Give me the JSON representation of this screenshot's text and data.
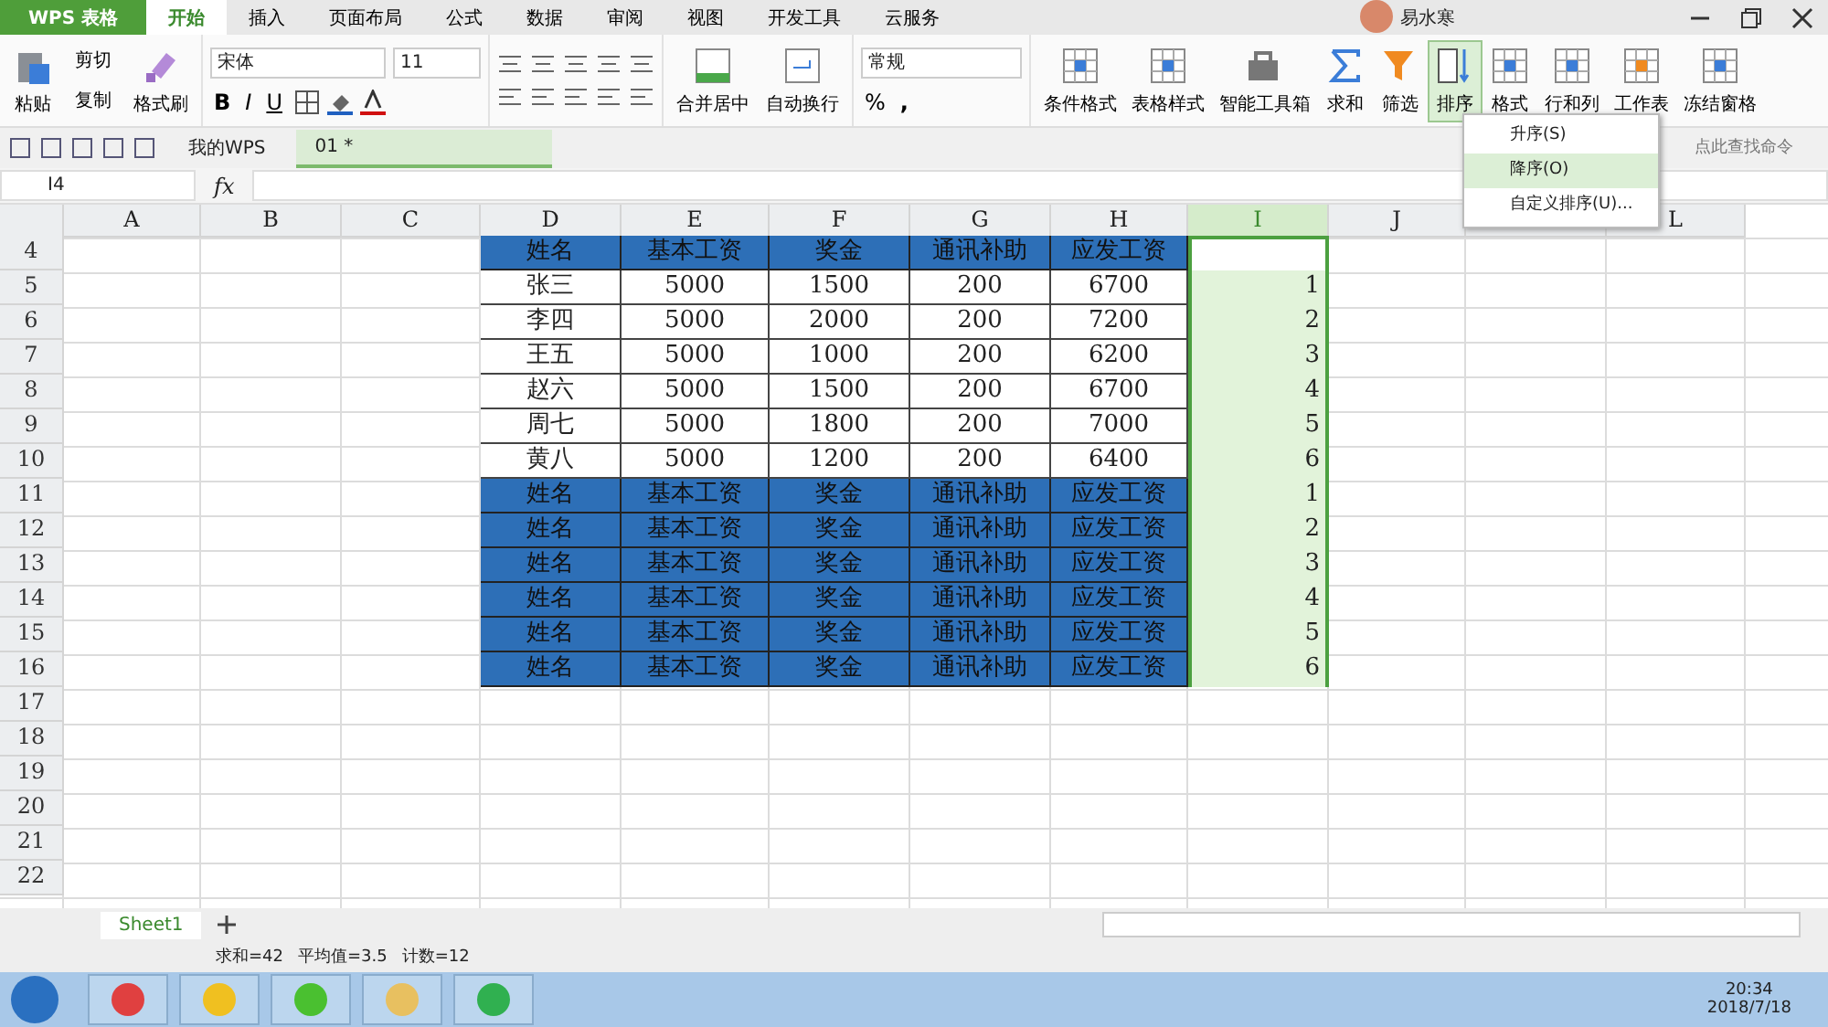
{
  "app_button": {
    "label": "WPS 表格"
  },
  "menu_tabs": [
    {
      "label": "开始",
      "selected": true
    },
    {
      "label": "插入",
      "selected": false
    },
    {
      "label": "页面布局",
      "selected": false
    },
    {
      "label": "公式",
      "selected": false
    },
    {
      "label": "数据",
      "selected": false
    },
    {
      "label": "审阅",
      "selected": false
    },
    {
      "label": "视图",
      "selected": false
    },
    {
      "label": "开发工具",
      "selected": false
    },
    {
      "label": "云服务",
      "selected": false
    }
  ],
  "user": {
    "name": "易水寒"
  },
  "ribbon": {
    "paste": "粘贴",
    "cut": "剪切",
    "copy": "复制",
    "format_painter": "格式刷",
    "font": "宋体",
    "font_size": "11",
    "bold": "B",
    "italic": "I",
    "underline": "U",
    "merge": "合并居中",
    "wrap": "自动换行",
    "number_format": "常规",
    "percent": "%",
    "comma": ",",
    "big_buttons": [
      {
        "label": "条件格式",
        "kind": "cond",
        "active": false
      },
      {
        "label": "表格样式",
        "kind": "style",
        "active": false
      },
      {
        "label": "智能工具箱",
        "kind": "tools",
        "active": false
      },
      {
        "label": "求和",
        "kind": "sum",
        "active": false
      },
      {
        "label": "筛选",
        "kind": "filter",
        "active": false
      },
      {
        "label": "排序",
        "kind": "sort",
        "active": true
      },
      {
        "label": "格式",
        "kind": "format",
        "active": false
      },
      {
        "label": "行和列",
        "kind": "rowcol",
        "active": false
      },
      {
        "label": "工作表",
        "kind": "sheet",
        "active": false
      },
      {
        "label": "冻结窗格",
        "kind": "freeze",
        "active": false
      }
    ]
  },
  "doc_tabs": [
    {
      "label": "我的WPS",
      "selected": false
    },
    {
      "label": "01 *",
      "selected": true
    }
  ],
  "command_search": {
    "placeholder": "点此查找命令"
  },
  "sort_menu": [
    {
      "label": "升序(S)",
      "selected": false
    },
    {
      "label": "降序(O)",
      "selected": true
    },
    {
      "label": "自定义排序(U)...",
      "selected": false
    }
  ],
  "formula_bar": {
    "cell": "I4",
    "fx": "fx"
  },
  "columns": [
    {
      "label": "A",
      "selected": false
    },
    {
      "label": "B",
      "selected": false
    },
    {
      "label": "C",
      "selected": false
    },
    {
      "label": "D",
      "selected": false
    },
    {
      "label": "E",
      "selected": false
    },
    {
      "label": "F",
      "selected": false
    },
    {
      "label": "G",
      "selected": false
    },
    {
      "label": "H",
      "selected": false
    },
    {
      "label": "I",
      "selected": true
    },
    {
      "label": "J",
      "selected": false
    },
    {
      "selected": false
    },
    {
      "label": "L",
      "selected": false
    }
  ],
  "rows": [
    {
      "num": "4",
      "kind": "header",
      "cells": [
        "姓名",
        "基本工资",
        "奖金",
        "通讯补助",
        "应发工资"
      ],
      "index": ""
    },
    {
      "num": "5",
      "kind": "data",
      "cells": [
        "张三",
        "5000",
        "1500",
        "200",
        "6700"
      ],
      "index": "1"
    },
    {
      "num": "6",
      "kind": "data",
      "cells": [
        "李四",
        "5000",
        "2000",
        "200",
        "7200"
      ],
      "index": "2"
    },
    {
      "num": "7",
      "kind": "data",
      "cells": [
        "王五",
        "5000",
        "1000",
        "200",
        "6200"
      ],
      "index": "3"
    },
    {
      "num": "8",
      "kind": "data",
      "cells": [
        "赵六",
        "5000",
        "1500",
        "200",
        "6700"
      ],
      "index": "4"
    },
    {
      "num": "9",
      "kind": "data",
      "cells": [
        "周七",
        "5000",
        "1800",
        "200",
        "7000"
      ],
      "index": "5"
    },
    {
      "num": "10",
      "kind": "data",
      "cells": [
        "黄八",
        "5000",
        "1200",
        "200",
        "6400"
      ],
      "index": "6"
    },
    {
      "num": "11",
      "kind": "header",
      "cells": [
        "姓名",
        "基本工资",
        "奖金",
        "通讯补助",
        "应发工资"
      ],
      "index": "1"
    },
    {
      "num": "12",
      "kind": "header",
      "cells": [
        "姓名",
        "基本工资",
        "奖金",
        "通讯补助",
        "应发工资"
      ],
      "index": "2"
    },
    {
      "num": "13",
      "kind": "header",
      "cells": [
        "姓名",
        "基本工资",
        "奖金",
        "通讯补助",
        "应发工资"
      ],
      "index": "3"
    },
    {
      "num": "14",
      "kind": "header",
      "cells": [
        "姓名",
        "基本工资",
        "奖金",
        "通讯补助",
        "应发工资"
      ],
      "index": "4"
    },
    {
      "num": "15",
      "kind": "header",
      "cells": [
        "姓名",
        "基本工资",
        "奖金",
        "通讯补助",
        "应发工资"
      ],
      "index": "5"
    },
    {
      "num": "16",
      "kind": "header",
      "cells": [
        "姓名",
        "基本工资",
        "奖金",
        "通讯补助",
        "应发工资"
      ],
      "index": "6"
    },
    {
      "num": "17",
      "kind": "empty",
      "cells": [],
      "index": ""
    },
    {
      "num": "18",
      "kind": "empty",
      "cells": [],
      "index": ""
    },
    {
      "num": "19",
      "kind": "empty",
      "cells": [],
      "index": ""
    },
    {
      "num": "20",
      "kind": "empty",
      "cells": [],
      "index": ""
    },
    {
      "num": "21",
      "kind": "empty",
      "cells": [],
      "index": ""
    },
    {
      "num": "22",
      "kind": "empty",
      "cells": [],
      "index": ""
    }
  ],
  "sheet_tabs": [
    {
      "label": "Sheet1",
      "selected": true
    }
  ],
  "status_bar": [
    "求和=42",
    "平均值=3.5",
    "计数=12"
  ],
  "taskbar": {
    "time": "20:34",
    "date": "2018/7/18"
  }
}
